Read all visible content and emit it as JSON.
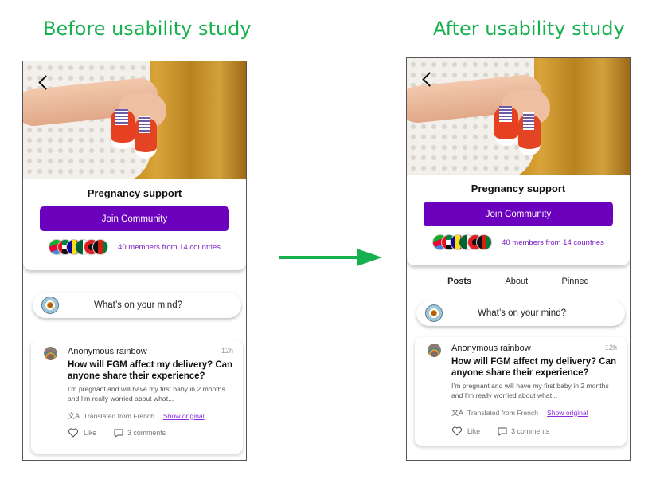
{
  "headings": {
    "before": "Before usability study",
    "after": "After usability study"
  },
  "colors": {
    "heading_green": "#16b04e",
    "brand_purple": "#6b00bd",
    "link_purple": "#8a2be2"
  },
  "screens": [
    {
      "label": "before",
      "back_icon": "chevron-left-icon",
      "community_title": "Pregnancy support",
      "join_label": "Join Community",
      "flags": [
        "eritrea",
        "uae",
        "andorra",
        "algeria",
        "albania",
        "afghanistan"
      ],
      "members_text": "40 members from 14 countries",
      "composer_placeholder": "What’s on your mind?",
      "post": {
        "author": "Anonymous rainbow",
        "time": "12h",
        "title": "How will FGM affect my delivery? Can anyone share their experience?",
        "body": "I’m pregnant and will have my first baby in 2 months and I’m really worried about what...",
        "translated": "Translated from French",
        "show_original": "Show original",
        "like": "Like",
        "comments": "3 comments"
      }
    },
    {
      "label": "after",
      "back_icon": "chevron-left-icon",
      "community_title": "Pregnancy support",
      "join_label": "Join Community",
      "flags": [
        "eritrea",
        "uae",
        "andorra",
        "algeria",
        "albania",
        "afghanistan"
      ],
      "members_text": "40 members from 14 countries",
      "tabs": [
        {
          "label": "Posts",
          "active": true
        },
        {
          "label": "About",
          "active": false
        },
        {
          "label": "Pinned",
          "active": false
        }
      ],
      "composer_placeholder": "What’s on your mind?",
      "post": {
        "author": "Anonymous rainbow",
        "time": "12h",
        "title": "How will FGM affect my delivery? Can anyone share their experience?",
        "body": "I’m pregnant and will have my first baby in 2 months and I’m really worried about what...",
        "translated": "Translated from French",
        "show_original": "Show original",
        "like": "Like",
        "comments": "3 comments"
      }
    }
  ]
}
